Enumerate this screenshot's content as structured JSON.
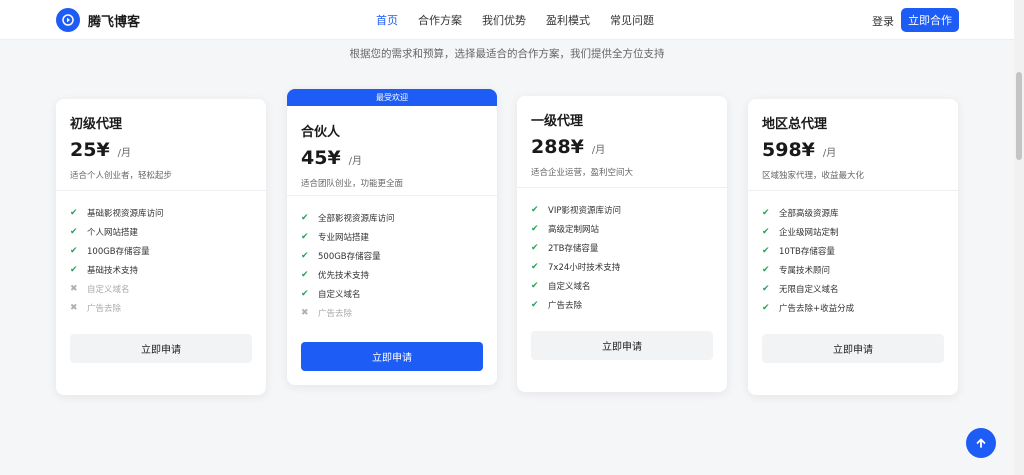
{
  "brand": {
    "name": "腾飞博客"
  },
  "nav": {
    "items": [
      "首页",
      "合作方案",
      "我们优势",
      "盈利模式",
      "常见问题"
    ],
    "active_index": 0
  },
  "header": {
    "login": "登录",
    "cta": "立即合作"
  },
  "intro": {
    "subtitle": "根据您的需求和预算，选择最适合的合作方案，我们提供全方位支持"
  },
  "plans": [
    {
      "name": "初级代理",
      "price": "25¥",
      "unit": "/月",
      "desc": "适合个人创业者，轻松起步",
      "badge": "",
      "button": "立即申请",
      "primary": false,
      "features": [
        {
          "text": "基础影视资源库访问",
          "included": true
        },
        {
          "text": "个人网站搭建",
          "included": true
        },
        {
          "text": "100GB存储容量",
          "included": true
        },
        {
          "text": "基础技术支持",
          "included": true
        },
        {
          "text": "自定义域名",
          "included": false
        },
        {
          "text": "广告去除",
          "included": false
        }
      ]
    },
    {
      "name": "合伙人",
      "price": "45¥",
      "unit": "/月",
      "desc": "适合团队创业，功能更全面",
      "badge": "最受欢迎",
      "button": "立即申请",
      "primary": true,
      "features": [
        {
          "text": "全部影视资源库访问",
          "included": true
        },
        {
          "text": "专业网站搭建",
          "included": true
        },
        {
          "text": "500GB存储容量",
          "included": true
        },
        {
          "text": "优先技术支持",
          "included": true
        },
        {
          "text": "自定义域名",
          "included": true
        },
        {
          "text": "广告去除",
          "included": false
        }
      ]
    },
    {
      "name": "一级代理",
      "price": "288¥",
      "unit": "/月",
      "desc": "适合企业运营，盈利空间大",
      "badge": "",
      "button": "立即申请",
      "primary": false,
      "features": [
        {
          "text": "VIP影视资源库访问",
          "included": true
        },
        {
          "text": "高级定制网站",
          "included": true
        },
        {
          "text": "2TB存储容量",
          "included": true
        },
        {
          "text": "7x24小时技术支持",
          "included": true
        },
        {
          "text": "自定义域名",
          "included": true
        },
        {
          "text": "广告去除",
          "included": true
        }
      ]
    },
    {
      "name": "地区总代理",
      "price": "598¥",
      "unit": "/月",
      "desc": "区域独家代理，收益最大化",
      "badge": "",
      "button": "立即申请",
      "primary": false,
      "features": [
        {
          "text": "全部高级资源库",
          "included": true
        },
        {
          "text": "企业级网站定制",
          "included": true
        },
        {
          "text": "10TB存储容量",
          "included": true
        },
        {
          "text": "专属技术顾问",
          "included": true
        },
        {
          "text": "无限自定义域名",
          "included": true
        },
        {
          "text": "广告去除+收益分成",
          "included": true
        }
      ]
    }
  ],
  "icons": {
    "check": "check-icon",
    "cross": "cross-icon",
    "back_to_top": "arrow-up-icon",
    "logo": "play-icon"
  },
  "colors": {
    "accent": "#1d5cf5",
    "check": "#22a35a",
    "muted": "#b0b0b0"
  }
}
